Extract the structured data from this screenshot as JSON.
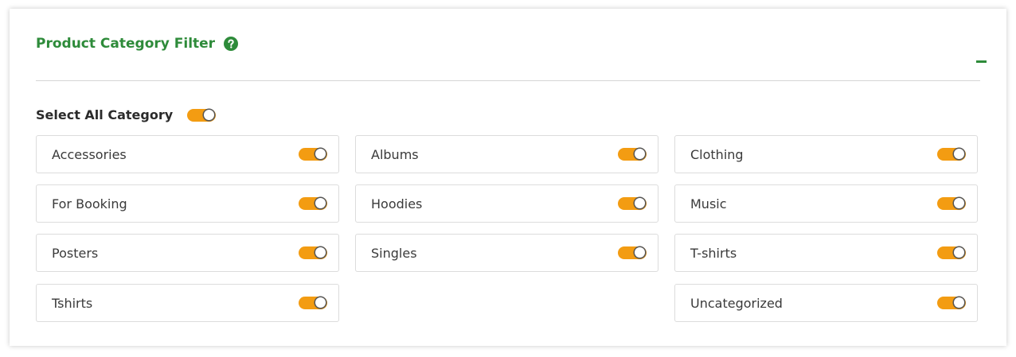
{
  "panel": {
    "title": "Product Category Filter",
    "help_icon": "question-circle-icon",
    "collapse_icon": "minus-icon"
  },
  "select_all": {
    "label": "Select All Category",
    "enabled": true
  },
  "categories": [
    {
      "label": "Accessories",
      "enabled": true
    },
    {
      "label": "Albums",
      "enabled": true
    },
    {
      "label": "Clothing",
      "enabled": true
    },
    {
      "label": "For Booking",
      "enabled": true
    },
    {
      "label": "Hoodies",
      "enabled": true
    },
    {
      "label": "Music",
      "enabled": true
    },
    {
      "label": "Posters",
      "enabled": true
    },
    {
      "label": "Singles",
      "enabled": true
    },
    {
      "label": "T-shirts",
      "enabled": true
    },
    {
      "label": "Tshirts",
      "enabled": true
    },
    {
      "label": "Uncategorized",
      "enabled": true
    }
  ],
  "colors": {
    "title": "#2e8b3a",
    "toggle_on": "#f39c12",
    "border": "#dcdcdc"
  }
}
